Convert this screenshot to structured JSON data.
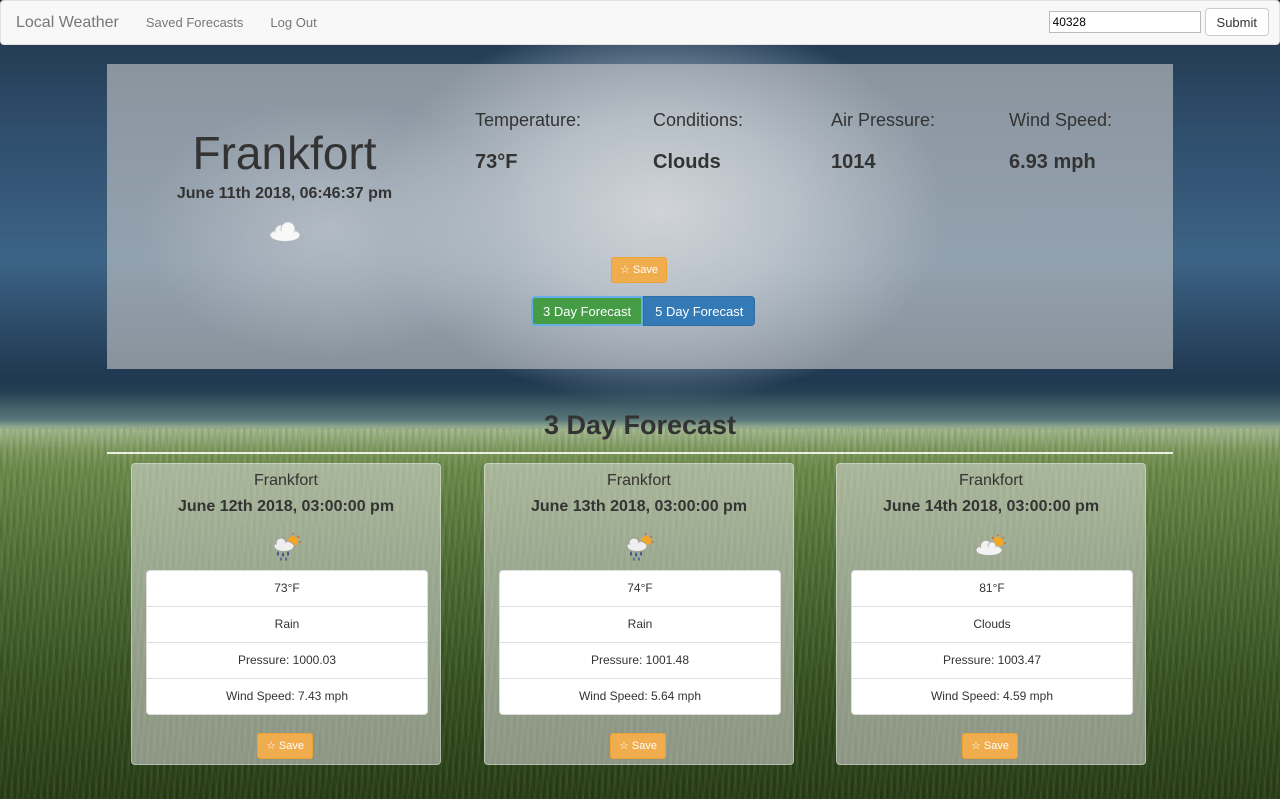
{
  "navbar": {
    "brand": "Local Weather",
    "links": [
      "Saved Forecasts",
      "Log Out"
    ],
    "zip_value": "40328",
    "submit_label": "Submit"
  },
  "current": {
    "city": "Frankfort",
    "datetime": "June 11th 2018, 06:46:37 pm",
    "icon": "cloud-icon",
    "stats": [
      {
        "label": "Temperature:",
        "value": "73°F"
      },
      {
        "label": "Conditions:",
        "value": "Clouds"
      },
      {
        "label": "Air Pressure:",
        "value": "1014"
      },
      {
        "label": "Wind Speed:",
        "value": "6.93 mph"
      }
    ],
    "save_label": "☆ Save",
    "forecast_buttons": {
      "three": "3 Day Forecast",
      "five": "5 Day Forecast"
    }
  },
  "forecast": {
    "heading": "3 Day Forecast",
    "cards": [
      {
        "city": "Frankfort",
        "date": "June 12th 2018, 03:00:00 pm",
        "icon": "rain-sun-icon",
        "temp": "73°F",
        "conditions": "Rain",
        "pressure": "Pressure: 1000.03",
        "wind": "Wind Speed: 7.43 mph",
        "save_label": "☆ Save"
      },
      {
        "city": "Frankfort",
        "date": "June 13th 2018, 03:00:00 pm",
        "icon": "rain-sun-icon",
        "temp": "74°F",
        "conditions": "Rain",
        "pressure": "Pressure: 1001.48",
        "wind": "Wind Speed: 5.64 mph",
        "save_label": "☆ Save"
      },
      {
        "city": "Frankfort",
        "date": "June 14th 2018, 03:00:00 pm",
        "icon": "cloud-sun-icon",
        "temp": "81°F",
        "conditions": "Clouds",
        "pressure": "Pressure: 1003.47",
        "wind": "Wind Speed: 4.59 mph",
        "save_label": "☆ Save"
      }
    ]
  },
  "colors": {
    "save_button": "#f0ad4e",
    "three_day_button": "#449d44",
    "five_day_button": "#337ab7"
  }
}
